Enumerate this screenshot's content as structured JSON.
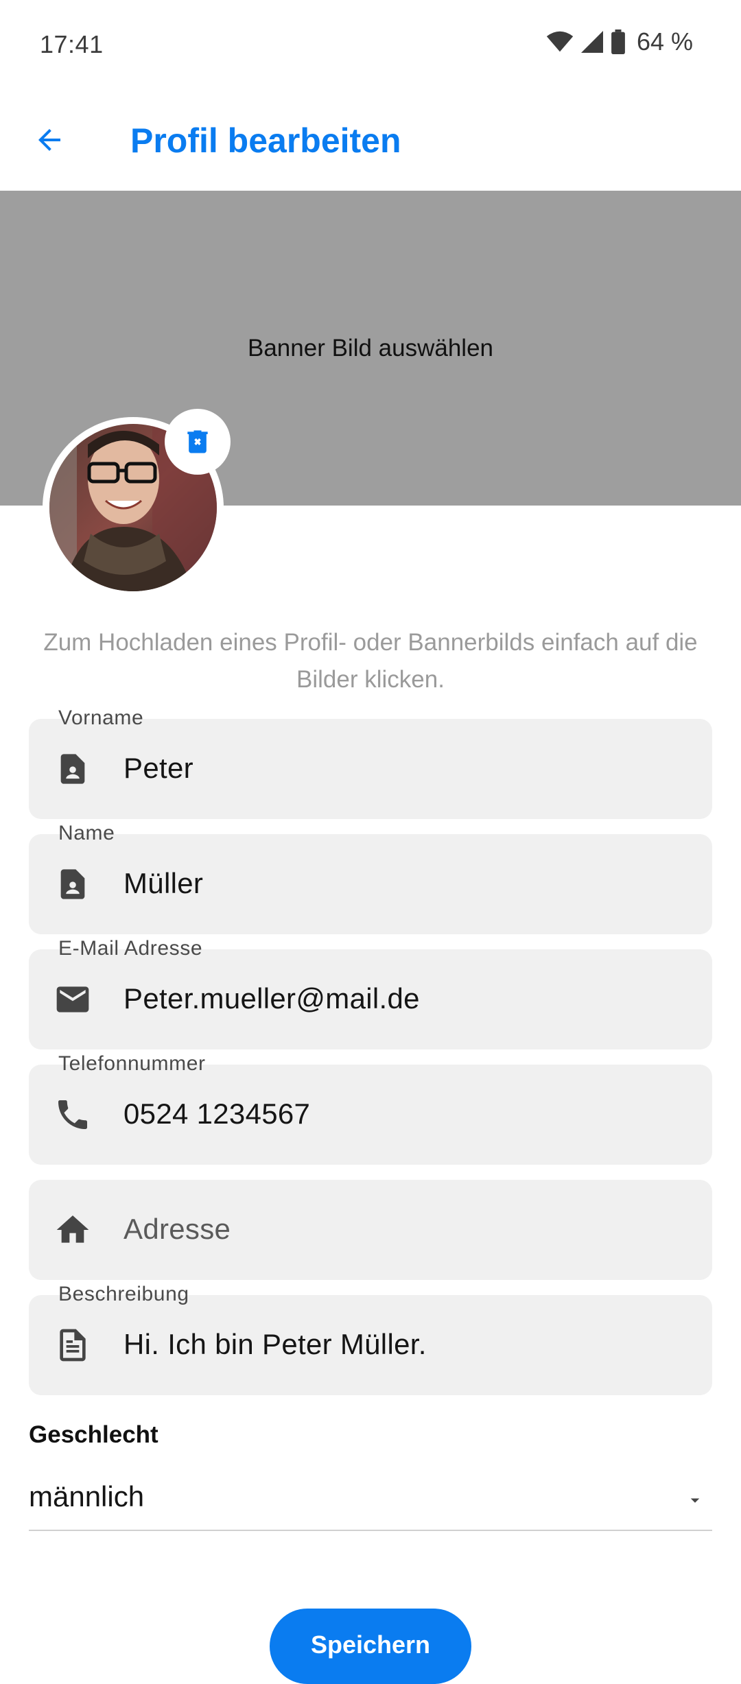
{
  "status_bar": {
    "time": "17:41",
    "battery": "64 %"
  },
  "header": {
    "title": "Profil bearbeiten"
  },
  "banner": {
    "label": "Banner Bild auswählen"
  },
  "hint": "Zum Hochladen eines Profil- oder Bannerbilds einfach auf die Bilder klicken.",
  "fields": {
    "firstname": {
      "label": "Vorname",
      "value": "Peter",
      "icon": "contact-card-icon"
    },
    "lastname": {
      "label": "Name",
      "value": "Müller",
      "icon": "contact-card-icon"
    },
    "email": {
      "label": "E-Mail Adresse",
      "value": "Peter.mueller@mail.de",
      "icon": "mail-icon"
    },
    "phone": {
      "label": "Telefonnummer",
      "value": "0524 1234567",
      "icon": "phone-icon"
    },
    "address": {
      "placeholder": "Adresse",
      "icon": "home-icon"
    },
    "description": {
      "label": "Beschreibung",
      "value": "Hi. Ich bin Peter Müller.",
      "icon": "document-icon"
    }
  },
  "gender": {
    "label": "Geschlecht",
    "selected": "männlich"
  },
  "actions": {
    "save_label": "Speichern"
  },
  "colors": {
    "accent": "#0a7cf0",
    "banner": "#9e9e9e",
    "field_bg": "#f0f0f0"
  }
}
